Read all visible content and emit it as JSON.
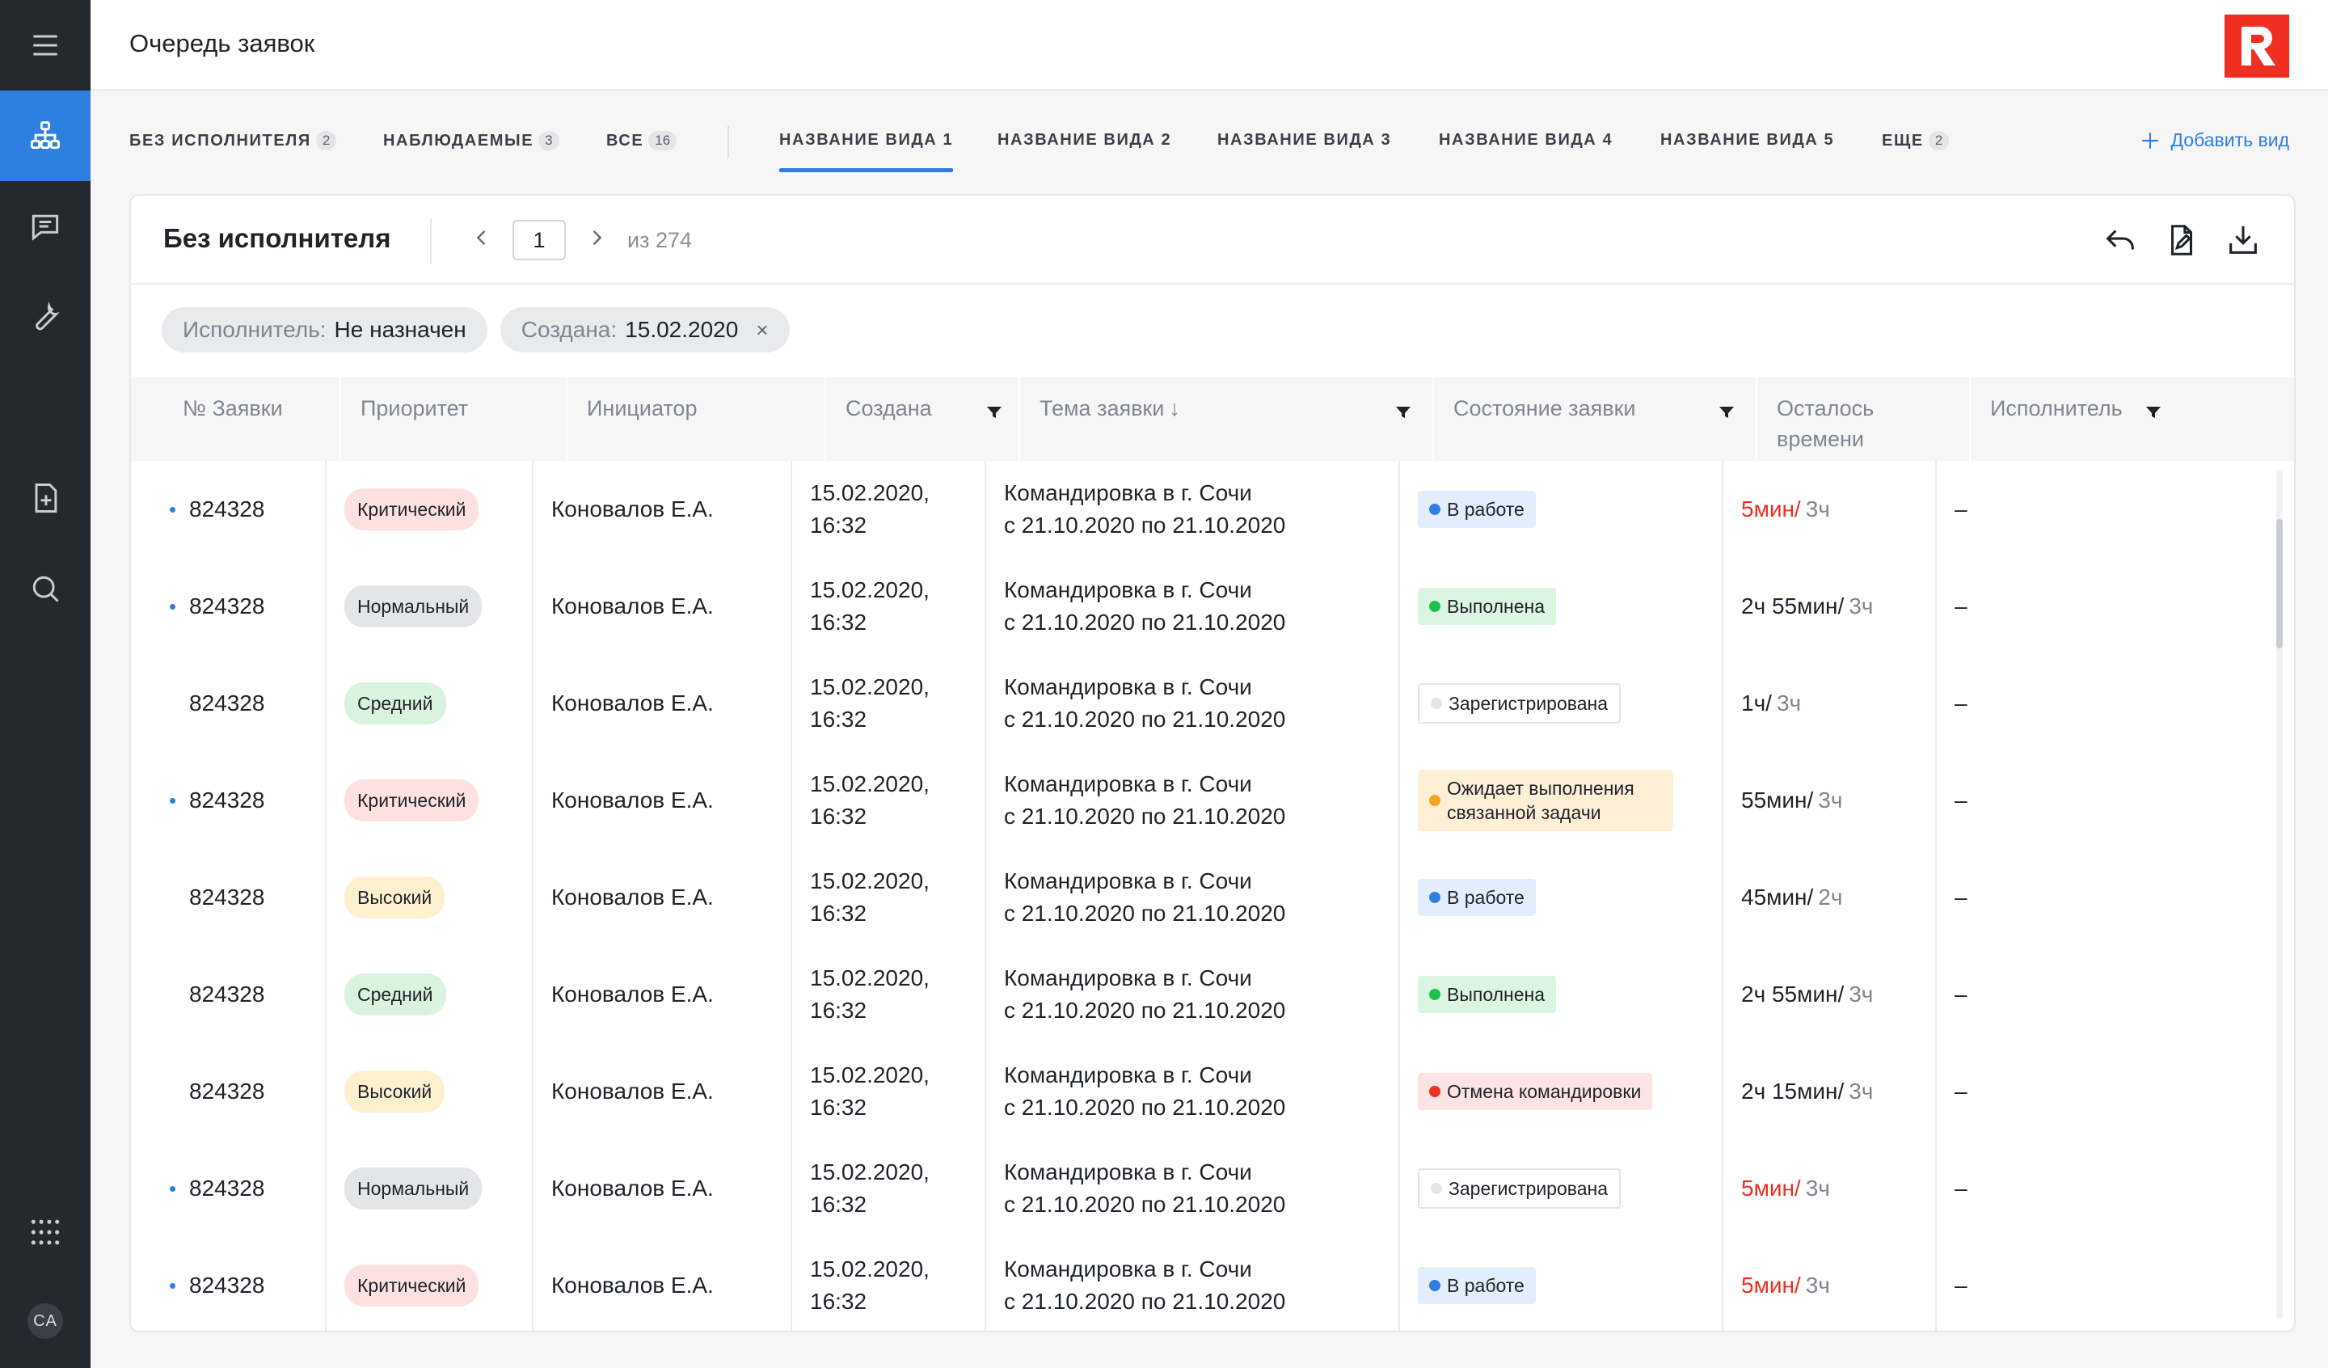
{
  "sidebar": {
    "icons": [
      "menu-icon",
      "hierarchy-icon",
      "chat-icon",
      "wrench-icon",
      "add-document-icon",
      "search-icon",
      "apps-grid-icon"
    ],
    "avatar_initials": "CA"
  },
  "header": {
    "title": "Очередь заявок",
    "logo_letter": "R",
    "brand_color": "#ee2f22"
  },
  "tabs": {
    "items": [
      {
        "label": "БЕЗ ИСПОЛНИТЕЛЯ",
        "count": "2"
      },
      {
        "label": "НАБЛЮДАЕМЫЕ",
        "count": "3"
      },
      {
        "label": "ВСЕ",
        "count": "16"
      },
      {
        "label": "НАЗВАНИЕ ВИДА 1",
        "count": "",
        "active": true
      },
      {
        "label": "НАЗВАНИЕ ВИДА 2",
        "count": ""
      },
      {
        "label": "НАЗВАНИЕ ВИДА 3",
        "count": ""
      },
      {
        "label": "НАЗВАНИЕ ВИДА 4",
        "count": ""
      },
      {
        "label": "НАЗВАНИЕ ВИДА 5",
        "count": ""
      },
      {
        "label": "ЕЩЕ",
        "count": "2"
      }
    ],
    "add_view_label": "Добавить вид",
    "accent_color": "#2f7fe0"
  },
  "card": {
    "title": "Без исполнителя",
    "pager": {
      "page": "1",
      "of_label": "из 274"
    },
    "actions": [
      "undo-icon",
      "edit-document-icon",
      "download-icon"
    ]
  },
  "filters": [
    {
      "label": "Исполнитель:",
      "value": "Не назначен",
      "removable": false
    },
    {
      "label": "Создана:",
      "value": "15.02.2020",
      "removable": true,
      "remove_glyph": "×"
    }
  ],
  "table": {
    "columns": [
      {
        "label": "№ Заявки"
      },
      {
        "label": "Приоритет"
      },
      {
        "label": "Инициатор"
      },
      {
        "label": "Создана",
        "filter": true
      },
      {
        "label": "Тема заявки",
        "sort": "↓",
        "filter": true
      },
      {
        "label": "Состояние заявки",
        "filter": true
      },
      {
        "label": "Осталось времени"
      },
      {
        "label": "Исполнитель",
        "filter": true
      }
    ],
    "rows": [
      {
        "num": "824328",
        "unread": true,
        "priority": "Критический",
        "pclass": "p-crit",
        "initiator": "Коновалов Е.А.",
        "created": "15.02.2020,\n16:32",
        "topic": "Командировка в г. Сочи\nс 21.10.2020 по 21.10.2020",
        "status": "В работе",
        "sclass": "s-work",
        "left": "5мин/",
        "left_red": true,
        "total": "3ч",
        "assignee": "–"
      },
      {
        "num": "824328",
        "unread": true,
        "priority": "Нормальный",
        "pclass": "p-norm",
        "initiator": "Коновалов Е.А.",
        "created": "15.02.2020,\n16:32",
        "topic": "Командировка в г. Сочи\nс 21.10.2020 по 21.10.2020",
        "status": "Выполнена",
        "sclass": "s-done",
        "left": "2ч 55мин/",
        "left_red": false,
        "total": "3ч",
        "assignee": "–"
      },
      {
        "num": "824328",
        "unread": false,
        "priority": "Средний",
        "pclass": "p-mid",
        "initiator": "Коновалов Е.А.",
        "created": "15.02.2020,\n16:32",
        "topic": "Командировка в г. Сочи\nс 21.10.2020 по 21.10.2020",
        "status": "Зарегистрирована",
        "sclass": "s-reg",
        "left": "1ч/",
        "left_red": false,
        "total": "3ч",
        "assignee": "–"
      },
      {
        "num": "824328",
        "unread": true,
        "priority": "Критический",
        "pclass": "p-crit",
        "initiator": "Коновалов Е.А.",
        "created": "15.02.2020,\n16:32",
        "topic": "Командировка в г. Сочи\nс 21.10.2020 по 21.10.2020",
        "status": "Ожидает выполнения связанной задачи",
        "sclass": "s-wait",
        "left": "55мин/",
        "left_red": false,
        "total": "3ч",
        "assignee": "–"
      },
      {
        "num": "824328",
        "unread": false,
        "priority": "Высокий",
        "pclass": "p-high",
        "initiator": "Коновалов Е.А.",
        "created": "15.02.2020,\n16:32",
        "topic": "Командировка в г. Сочи\nс 21.10.2020 по 21.10.2020",
        "status": "В работе",
        "sclass": "s-work",
        "left": "45мин/",
        "left_red": false,
        "total": "2ч",
        "assignee": "–"
      },
      {
        "num": "824328",
        "unread": false,
        "priority": "Средний",
        "pclass": "p-mid",
        "initiator": "Коновалов Е.А.",
        "created": "15.02.2020,\n16:32",
        "topic": "Командировка в г. Сочи\nс 21.10.2020 по 21.10.2020",
        "status": "Выполнена",
        "sclass": "s-done",
        "left": "2ч 55мин/",
        "left_red": false,
        "total": "3ч",
        "assignee": "–"
      },
      {
        "num": "824328",
        "unread": false,
        "priority": "Высокий",
        "pclass": "p-high",
        "initiator": "Коновалов Е.А.",
        "created": "15.02.2020,\n16:32",
        "topic": "Командировка в г. Сочи\nс 21.10.2020 по 21.10.2020",
        "status": "Отмена командировки",
        "sclass": "s-cancel",
        "left": "2ч 15мин/",
        "left_red": false,
        "total": "3ч",
        "assignee": "–"
      },
      {
        "num": "824328",
        "unread": true,
        "priority": "Нормальный",
        "pclass": "p-norm",
        "initiator": "Коновалов Е.А.",
        "created": "15.02.2020,\n16:32",
        "topic": "Командировка в г. Сочи\nс 21.10.2020 по 21.10.2020",
        "status": "Зарегистрирована",
        "sclass": "s-reg",
        "left": "5мин/",
        "left_red": true,
        "total": "3ч",
        "assignee": "–"
      },
      {
        "num": "824328",
        "unread": true,
        "priority": "Критический",
        "pclass": "p-crit",
        "initiator": "Коновалов Е.А.",
        "created": "15.02.2020,\n16:32",
        "topic": "Командировка в г. Сочи\nс 21.10.2020 по 21.10.2020",
        "status": "В работе",
        "sclass": "s-work",
        "left": "5мин/",
        "left_red": true,
        "total": "3ч",
        "assignee": "–"
      }
    ]
  }
}
